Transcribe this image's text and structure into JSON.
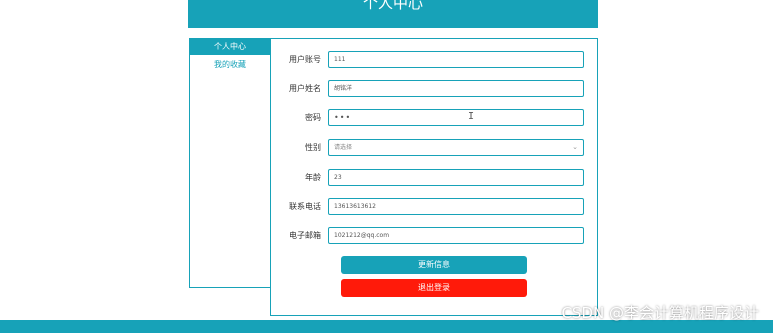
{
  "header": {
    "title": "个人中心"
  },
  "sidebar": {
    "items": [
      {
        "label": "个人中心"
      },
      {
        "label": "我的收藏"
      }
    ]
  },
  "form": {
    "username": {
      "label": "用户账号",
      "value": "111"
    },
    "name": {
      "label": "用户姓名",
      "value": "胡铭洋"
    },
    "password": {
      "label": "密码",
      "value": "•••"
    },
    "gender": {
      "label": "性别",
      "placeholder": "请选择"
    },
    "age": {
      "label": "年龄",
      "value": "23"
    },
    "phone": {
      "label": "联系电话",
      "value": "13613613612"
    },
    "email": {
      "label": "电子邮箱",
      "value": "1021212@qq.com"
    }
  },
  "buttons": {
    "update": "更新信息",
    "logout": "退出登录"
  },
  "watermark": "CSDN @李会计算机程序设计",
  "colors": {
    "accent": "#17a2b8",
    "danger": "#ff1a0a"
  },
  "icons": {
    "text_cursor": "I"
  }
}
